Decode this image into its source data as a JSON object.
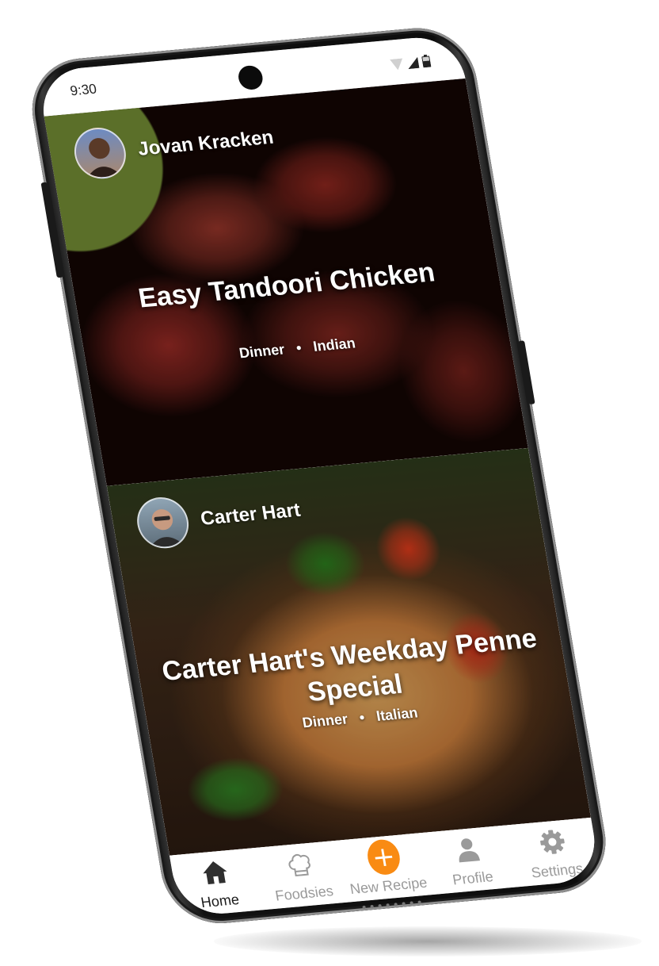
{
  "status_bar": {
    "time": "9:30"
  },
  "feed": [
    {
      "author": "Jovan Kracken",
      "title": "Easy Tandoori Chicken",
      "meal": "Dinner",
      "cuisine": "Indian"
    },
    {
      "author": "Carter Hart",
      "title": "Carter Hart's Weekday Penne Special",
      "meal": "Dinner",
      "cuisine": "Italian"
    }
  ],
  "nav": {
    "items": [
      {
        "label": "Home",
        "icon": "home-icon",
        "active": true
      },
      {
        "label": "Foodsies",
        "icon": "chef-hat-icon"
      },
      {
        "label": "New Recipe",
        "icon": "plus-icon"
      },
      {
        "label": "Profile",
        "icon": "person-icon"
      },
      {
        "label": "Settings",
        "icon": "gear-icon"
      }
    ]
  },
  "colors": {
    "accent": "#f98b13",
    "nav_active": "#1b1b1b",
    "nav_inactive": "#9a9a9a"
  }
}
